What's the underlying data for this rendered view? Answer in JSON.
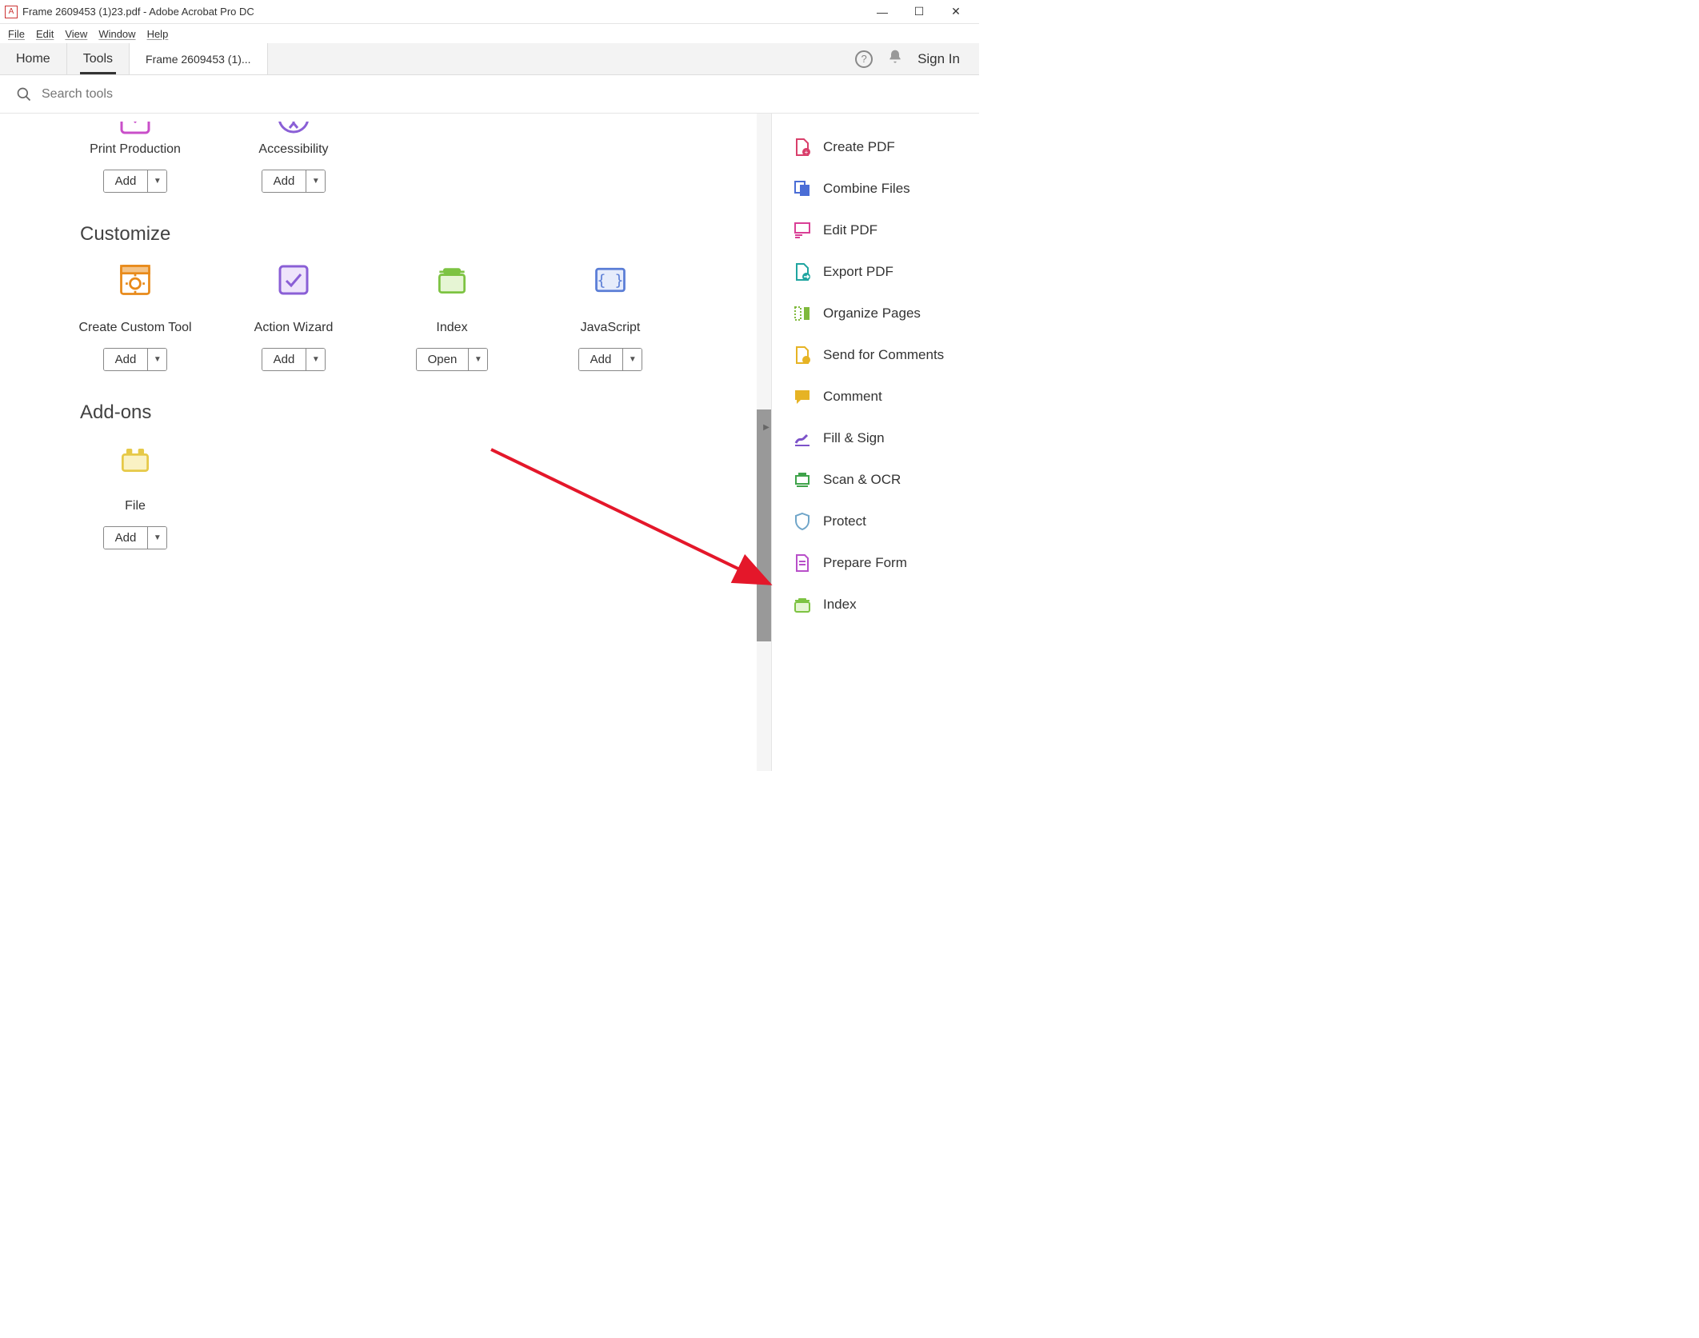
{
  "window": {
    "title": "Frame 2609453 (1)23.pdf - Adobe Acrobat Pro DC"
  },
  "menu": [
    "File",
    "Edit",
    "View",
    "Window",
    "Help"
  ],
  "tabs": {
    "home": "Home",
    "tools": "Tools",
    "doc": "Frame 2609453 (1)..."
  },
  "topright": {
    "signin": "Sign In"
  },
  "search": {
    "placeholder": "Search tools"
  },
  "partial_row": [
    {
      "label": "Print Production",
      "button": "Add"
    },
    {
      "label": "Accessibility",
      "button": "Add"
    }
  ],
  "sections": [
    {
      "heading": "Customize",
      "tools": [
        {
          "label": "Create Custom Tool",
          "button": "Add",
          "icon": "gear-box",
          "color": "#e88a1a"
        },
        {
          "label": "Action Wizard",
          "button": "Add",
          "icon": "check-box",
          "color": "#8a5fd6"
        },
        {
          "label": "Index",
          "button": "Open",
          "icon": "folder-tab",
          "color": "#7dc342"
        },
        {
          "label": "JavaScript",
          "button": "Add",
          "icon": "braces",
          "color": "#5a7dd6"
        }
      ]
    },
    {
      "heading": "Add-ons",
      "tools": [
        {
          "label": "File",
          "button": "Add",
          "icon": "lego",
          "color": "#e6c948"
        }
      ]
    }
  ],
  "right_panel": [
    {
      "label": "Create PDF",
      "icon": "create-pdf",
      "color": "#d93f6b"
    },
    {
      "label": "Combine Files",
      "icon": "combine",
      "color": "#4a6dd6"
    },
    {
      "label": "Edit PDF",
      "icon": "edit-pdf",
      "color": "#d93f96"
    },
    {
      "label": "Export PDF",
      "icon": "export-pdf",
      "color": "#1fa5a0"
    },
    {
      "label": "Organize Pages",
      "icon": "organize",
      "color": "#7fb93c"
    },
    {
      "label": "Send for Comments",
      "icon": "send-comments",
      "color": "#e6b324"
    },
    {
      "label": "Comment",
      "icon": "comment",
      "color": "#e6b324"
    },
    {
      "label": "Fill & Sign",
      "icon": "fill-sign",
      "color": "#7c52c9"
    },
    {
      "label": "Scan & OCR",
      "icon": "scan-ocr",
      "color": "#3fa34a"
    },
    {
      "label": "Protect",
      "icon": "protect",
      "color": "#6fa5c9"
    },
    {
      "label": "Prepare Form",
      "icon": "prepare-form",
      "color": "#b84fc9"
    },
    {
      "label": "Index",
      "icon": "folder-tab",
      "color": "#7dc342"
    }
  ]
}
